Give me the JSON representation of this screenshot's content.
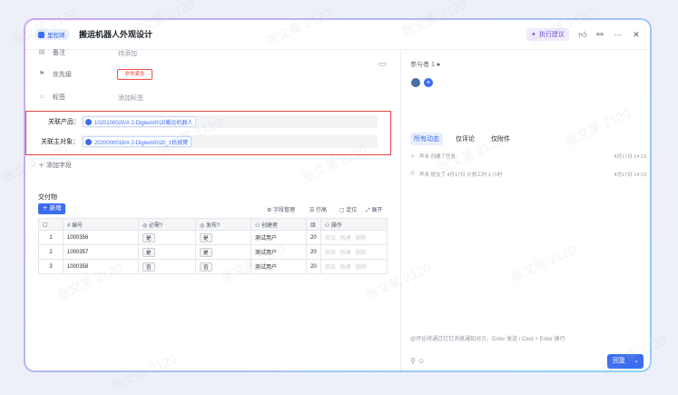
{
  "header": {
    "badge": "里程碑",
    "title": "搬运机器人外观设计",
    "suggest_label": "执行建议"
  },
  "fields": {
    "note_label": "备注",
    "note_value": "待添加",
    "priority_label": "优先级",
    "priority_value": "非常紧急",
    "tag_label": "标签",
    "tag_value": "添加标签",
    "related_product_label": "关联产品：",
    "related_product_value": "1020100020/A 2-Digiwin0020搬运机器人",
    "related_target_label": "关联主对象：",
    "related_target_value": "2020000018/A 2-Digiwin0020_1机械臂",
    "add_field": "添加字段"
  },
  "deliverables": {
    "title": "交付物",
    "new_button": "新增",
    "tools": [
      "字段管理",
      "行高",
      "定位",
      "展开"
    ],
    "columns": [
      "编号",
      "必需?",
      "发布?",
      "创建者",
      "操作"
    ],
    "rows": [
      {
        "index": "1",
        "id": "1000356",
        "required": "是",
        "publish": "是",
        "creator": "测试用户",
        "extra": "20"
      },
      {
        "index": "2",
        "id": "1000357",
        "required": "是",
        "publish": "是",
        "creator": "测试用户",
        "extra": "20"
      },
      {
        "index": "3",
        "id": "1000358",
        "required": "否",
        "publish": "否",
        "creator": "测试用户",
        "extra": "20"
      }
    ],
    "row_ops": [
      "添加",
      "新建",
      "删除"
    ]
  },
  "panel": {
    "participants_label": "参与者",
    "participants_count": "1",
    "tabs": [
      "所有动态",
      "仅评论",
      "仅附件"
    ],
    "activities": [
      {
        "text": "声禾 创建了任务",
        "time": "4月17日 14:13"
      },
      {
        "text": "声禾 提交了 4月17日 计划工时 1 小时",
        "time": "4月17日 14:13"
      }
    ],
    "comment_placeholder": "@评论将通过钉钉消息通知对方，Enter 发送 / Cmd + Enter 换行",
    "reply_button": "回复"
  },
  "watermark": "张文莱 2120",
  "colors": {
    "accent": "#3c6df0",
    "danger": "#e54545",
    "suggest": "#7a4be0"
  }
}
